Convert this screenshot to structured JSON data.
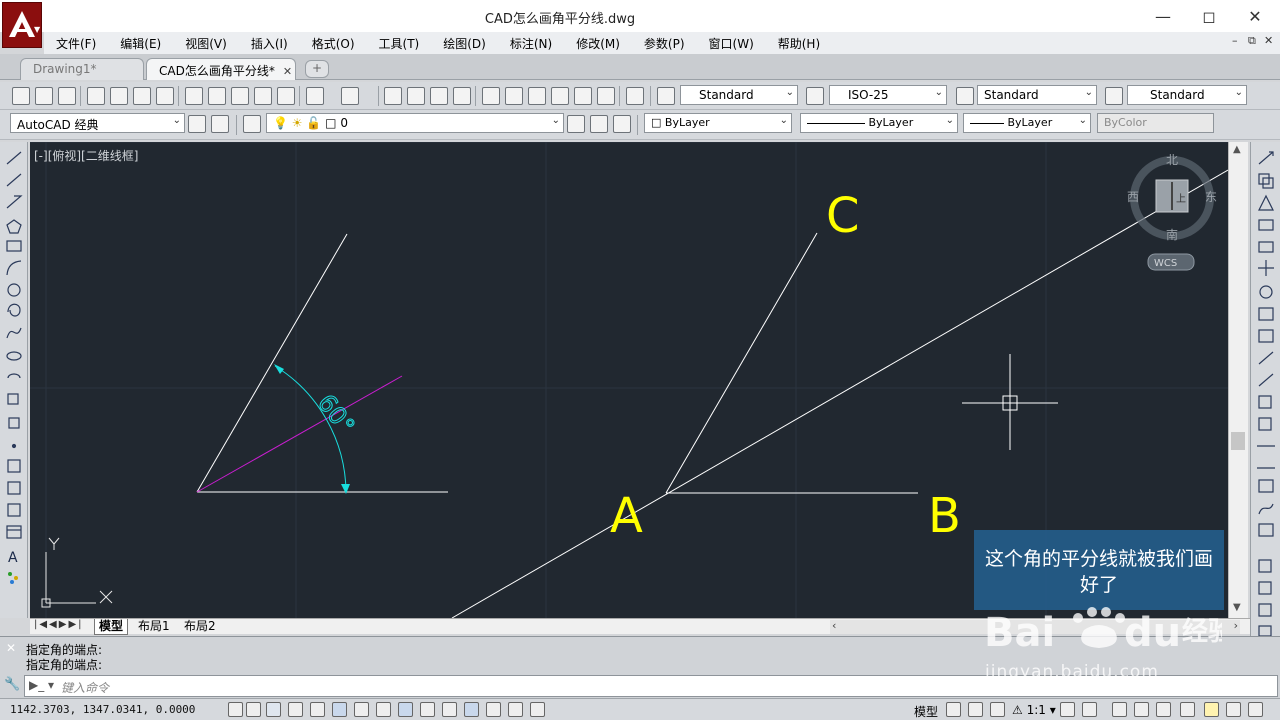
{
  "window": {
    "title": "CAD怎么画角平分线.dwg"
  },
  "menu": [
    "文件(F)",
    "编辑(E)",
    "视图(V)",
    "插入(I)",
    "格式(O)",
    "工具(T)",
    "绘图(D)",
    "标注(N)",
    "修改(M)",
    "参数(P)",
    "窗口(W)",
    "帮助(H)"
  ],
  "doc_tabs": [
    {
      "label": "Drawing1*",
      "active": false
    },
    {
      "label": "CAD怎么画角平分线*",
      "active": true
    }
  ],
  "toolbar1": {
    "text_style": "Standard",
    "dim_style": "ISO-25",
    "table_style": "Standard",
    "mleader_style": "Standard"
  },
  "toolbar2": {
    "workspace": "AutoCAD 经典",
    "layer": "0",
    "color": "ByLayer",
    "linetype": "ByLayer",
    "lineweight": "ByLayer",
    "plotstyle": "ByColor"
  },
  "viewport": {
    "label": "[-][俯视][二维线框]",
    "angle_text": "60°",
    "point_labels": [
      "A",
      "B",
      "C"
    ],
    "ucs_x": "X",
    "ucs_y": "Y"
  },
  "viewcube": {
    "north": "北",
    "south": "南",
    "east": "东",
    "west": "西",
    "top": "上",
    "wcs": "WCS"
  },
  "layout_tabs": [
    "模型",
    "布局1",
    "布局2"
  ],
  "command": {
    "history": [
      "指定角的端点:",
      "指定角的端点:"
    ],
    "placeholder": "键入命令"
  },
  "status": {
    "coords": "1142.3703, 1347.0341, 0.0000",
    "model": "模型",
    "scale": "1:1"
  },
  "overlay": {
    "caption": "这个角的平分线就被我们画好了",
    "watermark_sub": "jingyan.baidu.com"
  },
  "colors": {
    "canvas_bg": "#212830",
    "bisector": "#c81ecf",
    "dimension": "#19dede",
    "label": "#ffff00",
    "caption_bg": "#245c8a"
  }
}
